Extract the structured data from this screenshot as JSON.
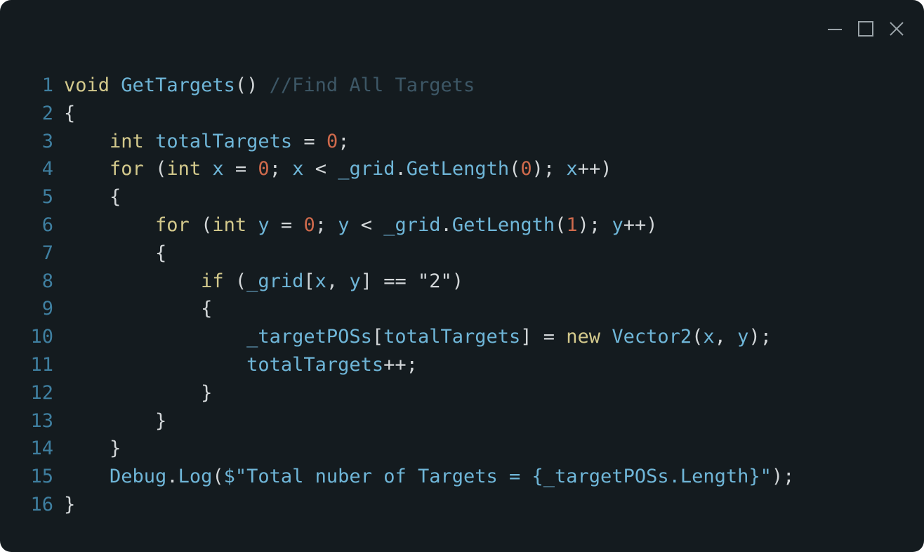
{
  "window": {
    "controls": {
      "minimize": "minimize-icon",
      "maximize": "maximize-icon",
      "close": "close-icon"
    }
  },
  "colors": {
    "background": "#141b1f",
    "line_number": "#3f7fa0",
    "keyword": "#d3c98c",
    "identifier": "#6fb6d8",
    "number": "#cf6a4c",
    "comment": "#3d5766",
    "punctuation": "#d2d6d8"
  },
  "code": {
    "lines": [
      {
        "n": "1",
        "tokens": [
          {
            "t": "void",
            "c": "kw"
          },
          {
            "t": " ",
            "c": "pn"
          },
          {
            "t": "GetTargets",
            "c": "fn"
          },
          {
            "t": "() ",
            "c": "pn"
          },
          {
            "t": "//Find All Targets",
            "c": "cm"
          }
        ]
      },
      {
        "n": "2",
        "tokens": [
          {
            "t": "{",
            "c": "pn"
          }
        ]
      },
      {
        "n": "3",
        "tokens": [
          {
            "t": "    ",
            "c": "pn"
          },
          {
            "t": "int",
            "c": "kw"
          },
          {
            "t": " ",
            "c": "pn"
          },
          {
            "t": "totalTargets",
            "c": "id"
          },
          {
            "t": " = ",
            "c": "pn"
          },
          {
            "t": "0",
            "c": "num"
          },
          {
            "t": ";",
            "c": "pn"
          }
        ]
      },
      {
        "n": "4",
        "tokens": [
          {
            "t": "    ",
            "c": "pn"
          },
          {
            "t": "for",
            "c": "kw"
          },
          {
            "t": " (",
            "c": "pn"
          },
          {
            "t": "int",
            "c": "kw"
          },
          {
            "t": " ",
            "c": "pn"
          },
          {
            "t": "x",
            "c": "id"
          },
          {
            "t": " = ",
            "c": "pn"
          },
          {
            "t": "0",
            "c": "num"
          },
          {
            "t": "; ",
            "c": "pn"
          },
          {
            "t": "x",
            "c": "id"
          },
          {
            "t": " < ",
            "c": "pn"
          },
          {
            "t": "_grid",
            "c": "id"
          },
          {
            "t": ".",
            "c": "pn"
          },
          {
            "t": "GetLength",
            "c": "fn"
          },
          {
            "t": "(",
            "c": "pn"
          },
          {
            "t": "0",
            "c": "num"
          },
          {
            "t": "); ",
            "c": "pn"
          },
          {
            "t": "x",
            "c": "id"
          },
          {
            "t": "++)",
            "c": "pn"
          }
        ]
      },
      {
        "n": "5",
        "tokens": [
          {
            "t": "    {",
            "c": "pn"
          }
        ]
      },
      {
        "n": "6",
        "tokens": [
          {
            "t": "        ",
            "c": "pn"
          },
          {
            "t": "for",
            "c": "kw"
          },
          {
            "t": " (",
            "c": "pn"
          },
          {
            "t": "int",
            "c": "kw"
          },
          {
            "t": " ",
            "c": "pn"
          },
          {
            "t": "y",
            "c": "id"
          },
          {
            "t": " = ",
            "c": "pn"
          },
          {
            "t": "0",
            "c": "num"
          },
          {
            "t": "; ",
            "c": "pn"
          },
          {
            "t": "y",
            "c": "id"
          },
          {
            "t": " < ",
            "c": "pn"
          },
          {
            "t": "_grid",
            "c": "id"
          },
          {
            "t": ".",
            "c": "pn"
          },
          {
            "t": "GetLength",
            "c": "fn"
          },
          {
            "t": "(",
            "c": "pn"
          },
          {
            "t": "1",
            "c": "num"
          },
          {
            "t": "); ",
            "c": "pn"
          },
          {
            "t": "y",
            "c": "id"
          },
          {
            "t": "++)",
            "c": "pn"
          }
        ]
      },
      {
        "n": "7",
        "tokens": [
          {
            "t": "        {",
            "c": "pn"
          }
        ]
      },
      {
        "n": "8",
        "tokens": [
          {
            "t": "            ",
            "c": "pn"
          },
          {
            "t": "if",
            "c": "kw"
          },
          {
            "t": " (",
            "c": "pn"
          },
          {
            "t": "_grid",
            "c": "id"
          },
          {
            "t": "[",
            "c": "pn"
          },
          {
            "t": "x",
            "c": "id"
          },
          {
            "t": ", ",
            "c": "pn"
          },
          {
            "t": "y",
            "c": "id"
          },
          {
            "t": "] == \"2\")",
            "c": "pn"
          }
        ]
      },
      {
        "n": "9",
        "tokens": [
          {
            "t": "            {",
            "c": "pn"
          }
        ]
      },
      {
        "n": "10",
        "tokens": [
          {
            "t": "                ",
            "c": "pn"
          },
          {
            "t": "_targetPOSs",
            "c": "id"
          },
          {
            "t": "[",
            "c": "pn"
          },
          {
            "t": "totalTargets",
            "c": "id"
          },
          {
            "t": "] = ",
            "c": "pn"
          },
          {
            "t": "new",
            "c": "kw"
          },
          {
            "t": " ",
            "c": "pn"
          },
          {
            "t": "Vector2",
            "c": "fn"
          },
          {
            "t": "(",
            "c": "pn"
          },
          {
            "t": "x",
            "c": "id"
          },
          {
            "t": ", ",
            "c": "pn"
          },
          {
            "t": "y",
            "c": "id"
          },
          {
            "t": ");",
            "c": "pn"
          }
        ]
      },
      {
        "n": "11",
        "tokens": [
          {
            "t": "                ",
            "c": "pn"
          },
          {
            "t": "totalTargets",
            "c": "id"
          },
          {
            "t": "++;",
            "c": "pn"
          }
        ]
      },
      {
        "n": "12",
        "tokens": [
          {
            "t": "            }",
            "c": "pn"
          }
        ]
      },
      {
        "n": "13",
        "tokens": [
          {
            "t": "        }",
            "c": "pn"
          }
        ]
      },
      {
        "n": "14",
        "tokens": [
          {
            "t": "    }",
            "c": "pn"
          }
        ]
      },
      {
        "n": "15",
        "tokens": [
          {
            "t": "    ",
            "c": "pn"
          },
          {
            "t": "Debug",
            "c": "id"
          },
          {
            "t": ".",
            "c": "pn"
          },
          {
            "t": "Log",
            "c": "fn"
          },
          {
            "t": "(",
            "c": "pn"
          },
          {
            "t": "$\"Total nuber of Targets = {_targetPOSs.Length}\"",
            "c": "str"
          },
          {
            "t": ");",
            "c": "pn"
          }
        ]
      },
      {
        "n": "16",
        "tokens": [
          {
            "t": "}",
            "c": "pn"
          }
        ]
      }
    ]
  }
}
